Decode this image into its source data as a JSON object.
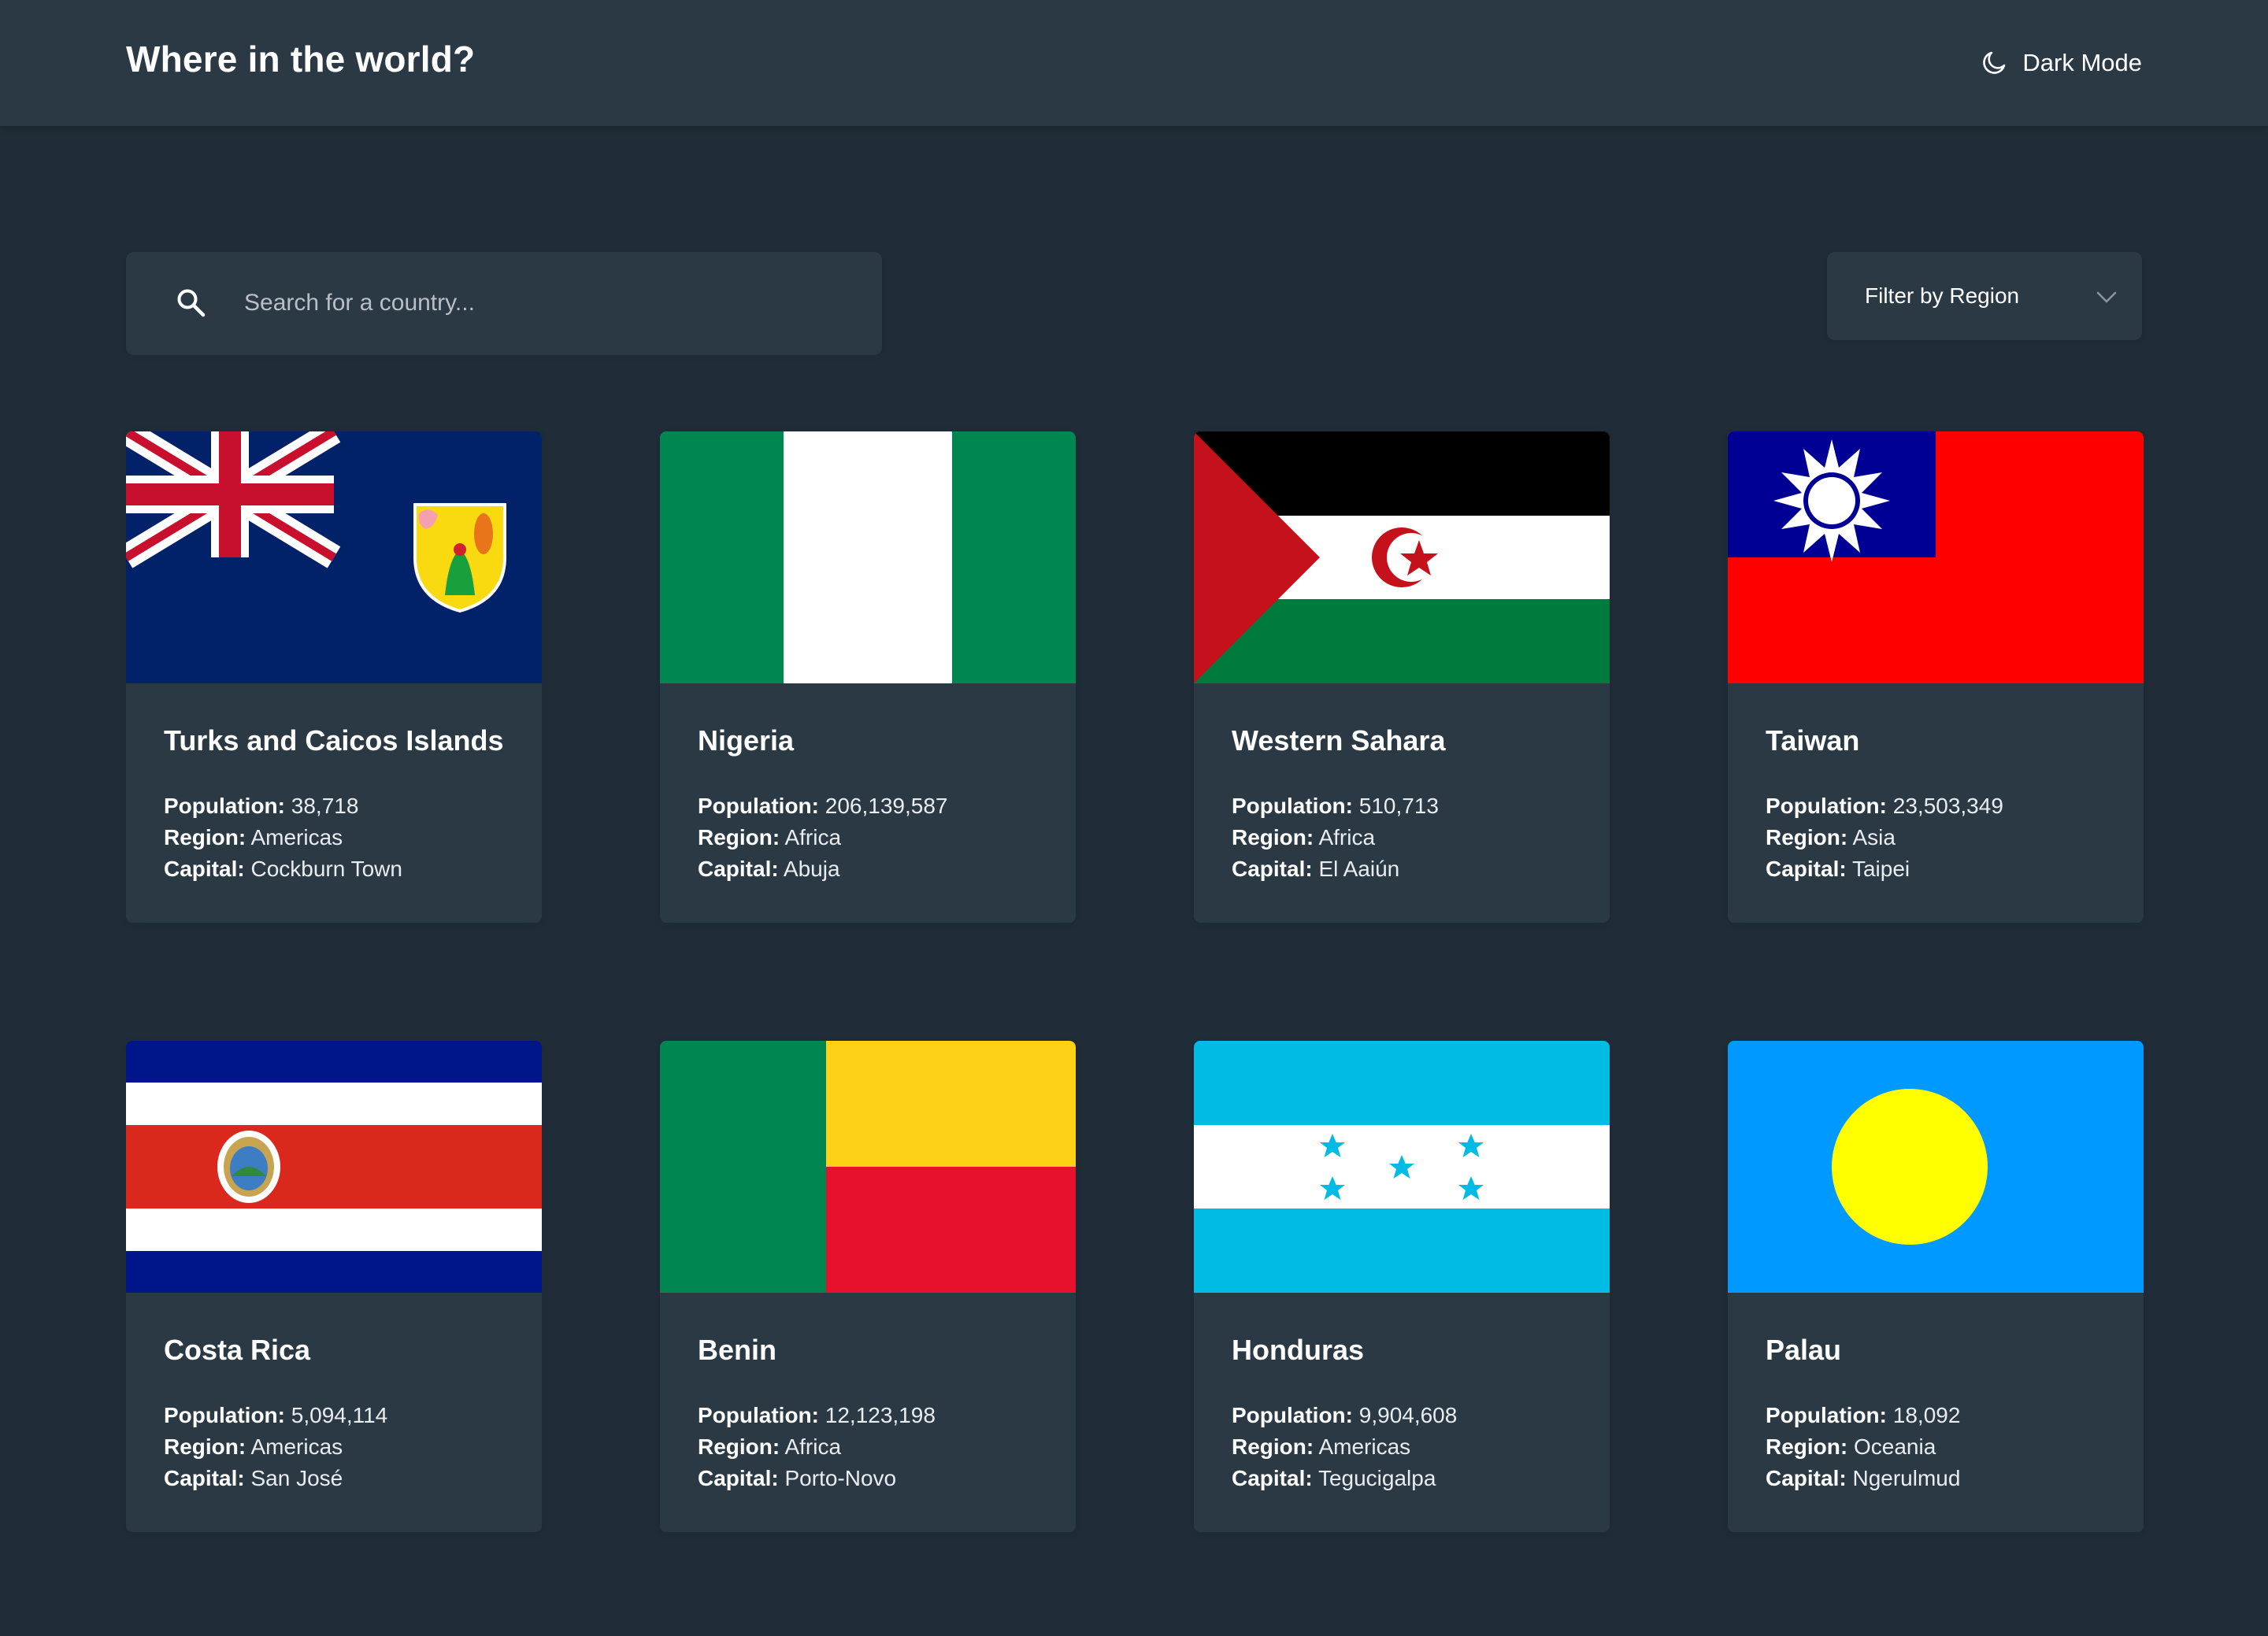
{
  "header": {
    "title": "Where in the world?",
    "mode_toggle_label": "Dark Mode",
    "mode_toggle_icon": "moon-icon"
  },
  "search": {
    "placeholder": "Search for a country...",
    "value": "",
    "icon": "search-icon"
  },
  "filter": {
    "label": "Filter by Region",
    "icon": "chevron-down-icon"
  },
  "labels": {
    "population": "Population:",
    "region": "Region:",
    "capital": "Capital:"
  },
  "colors": {
    "background": "#202c37",
    "element": "#2b3945",
    "text": "#ffffff",
    "placeholder": "#b8bfc6"
  },
  "countries": [
    {
      "name": "Turks and Caicos Islands",
      "population": "38,718",
      "region": "Americas",
      "capital": "Cockburn Town",
      "flag": "turks-and-caicos-flag"
    },
    {
      "name": "Nigeria",
      "population": "206,139,587",
      "region": "Africa",
      "capital": "Abuja",
      "flag": "nigeria-flag"
    },
    {
      "name": "Western Sahara",
      "population": "510,713",
      "region": "Africa",
      "capital": "El Aaiún",
      "flag": "western-sahara-flag"
    },
    {
      "name": "Taiwan",
      "population": "23,503,349",
      "region": "Asia",
      "capital": "Taipei",
      "flag": "taiwan-flag"
    },
    {
      "name": "Costa Rica",
      "population": "5,094,114",
      "region": "Americas",
      "capital": "San José",
      "flag": "costa-rica-flag"
    },
    {
      "name": "Benin",
      "population": "12,123,198",
      "region": "Africa",
      "capital": "Porto-Novo",
      "flag": "benin-flag"
    },
    {
      "name": "Honduras",
      "population": "9,904,608",
      "region": "Americas",
      "capital": "Tegucigalpa",
      "flag": "honduras-flag"
    },
    {
      "name": "Palau",
      "population": "18,092",
      "region": "Oceania",
      "capital": "Ngerulmud",
      "flag": "palau-flag"
    }
  ]
}
